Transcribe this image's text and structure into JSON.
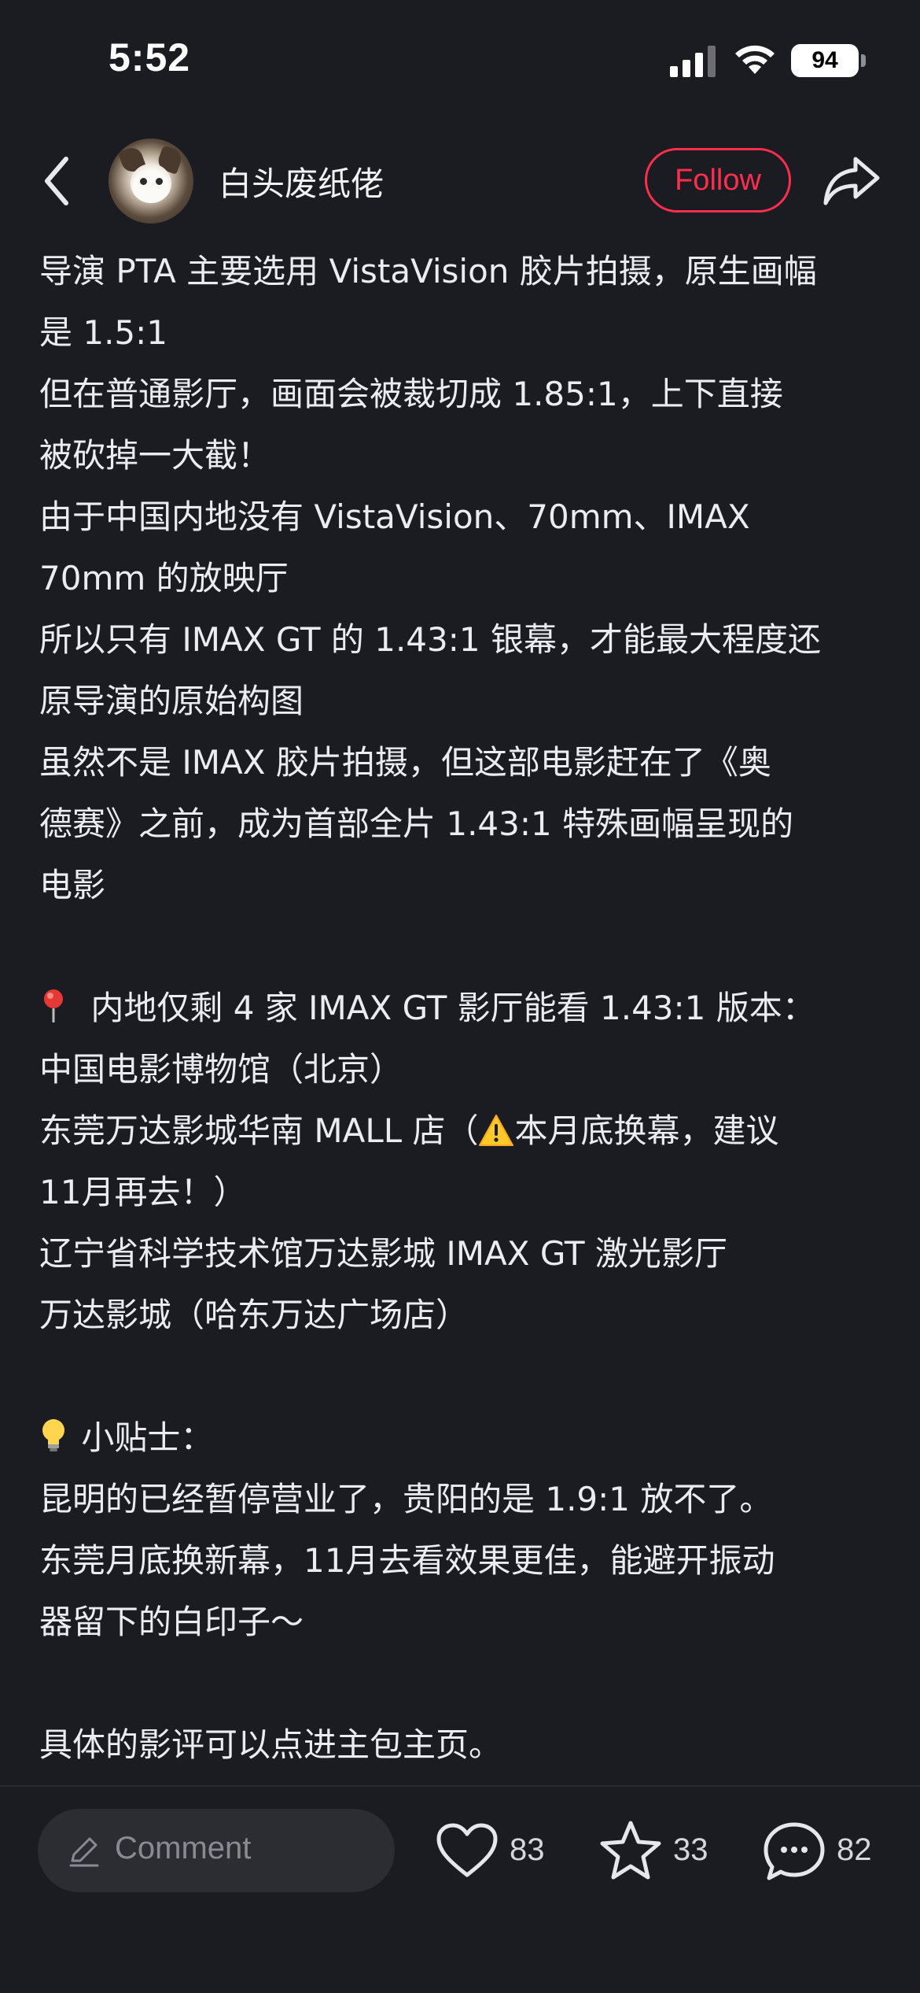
{
  "status_bar": {
    "time": "5:52",
    "battery_level": "94",
    "icons": [
      "cellular-signal-icon",
      "wifi-icon",
      "battery-icon"
    ]
  },
  "header": {
    "back_icon": "chevron-left-icon",
    "username": "白头废纸佬",
    "follow_label": "Follow",
    "share_icon": "share-icon",
    "accent_color": "#ff2e4d"
  },
  "content": {
    "lines": [
      "导演 PTA 主要选用 VistaVision 胶片拍摄，原生画幅",
      "是 1.5:1",
      "但在普通影厅，画面会被裁切成 1.85:1，上下直接",
      "被砍掉一大截！",
      "由于中国内地没有 VistaVision、70mm、IMAX",
      "70mm 的放映厅",
      "所以只有 IMAX GT 的 1.43:1 银幕，才能最大程度还",
      "原导演的原始构图",
      "虽然不是 IMAX 胶片拍摄，但这部电影赶在了《奥",
      "德赛》之前，成为首部全片 1.43:1 特殊画幅呈现的",
      "电影",
      "",
      "内地仅剩 4 家 IMAX GT 影厅能看 1.43:1 版本：",
      "中国电影博物馆（北京）",
      "东莞万达影城华南 MALL 店（",
      "本月底换幕，建议",
      "11月再去！）",
      "辽宁省科学技术馆万达影城 IMAX GT 激光影厅",
      "万达影城（哈东万达广场店）",
      "",
      "小贴士：",
      "昆明的已经暂停营业了，贵阳的是 1.9:1 放不了。",
      "东莞月底换新幕，11月去看效果更佳，能避开振动",
      "器留下的白印子～",
      "",
      "具体的影评可以点进主包主页。"
    ],
    "emoji_icons": [
      "pin-icon",
      "warning-icon",
      "lightbulb-icon"
    ]
  },
  "bottom_bar": {
    "comment_placeholder": "Comment",
    "likes": "83",
    "collects": "33",
    "comments": "82"
  }
}
